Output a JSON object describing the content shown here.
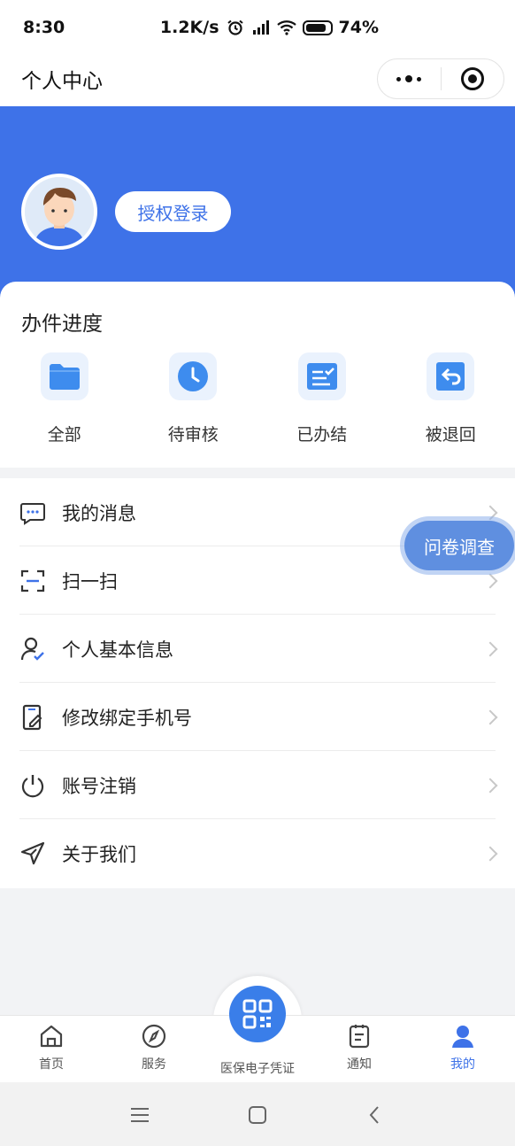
{
  "status_bar": {
    "time": "8:30",
    "net_speed": "1.2K/s",
    "battery": "74%"
  },
  "title_bar": {
    "title": "个人中心"
  },
  "header": {
    "login_button": "授权登录",
    "accent_color": "#3e72e8"
  },
  "progress": {
    "title": "办件进度",
    "items": [
      {
        "label": "全部",
        "icon": "folder-icon"
      },
      {
        "label": "待审核",
        "icon": "clock-icon"
      },
      {
        "label": "已办结",
        "icon": "checklist-icon"
      },
      {
        "label": "被退回",
        "icon": "return-icon"
      }
    ]
  },
  "menu": {
    "items": [
      {
        "label": "我的消息",
        "icon": "message-icon"
      },
      {
        "label": "扫一扫",
        "icon": "scan-icon"
      },
      {
        "label": "个人基本信息",
        "icon": "user-check-icon"
      },
      {
        "label": "修改绑定手机号",
        "icon": "phone-edit-icon"
      },
      {
        "label": "账号注销",
        "icon": "power-icon"
      },
      {
        "label": "关于我们",
        "icon": "send-icon"
      }
    ]
  },
  "survey_button": "问卷调查",
  "tab_bar": {
    "items": [
      {
        "label": "首页",
        "icon": "home-icon"
      },
      {
        "label": "服务",
        "icon": "compass-icon"
      },
      {
        "label": "医保电子凭证",
        "icon": "qrcode-icon"
      },
      {
        "label": "通知",
        "icon": "notice-icon"
      },
      {
        "label": "我的",
        "icon": "profile-icon"
      }
    ],
    "active": "我的"
  }
}
